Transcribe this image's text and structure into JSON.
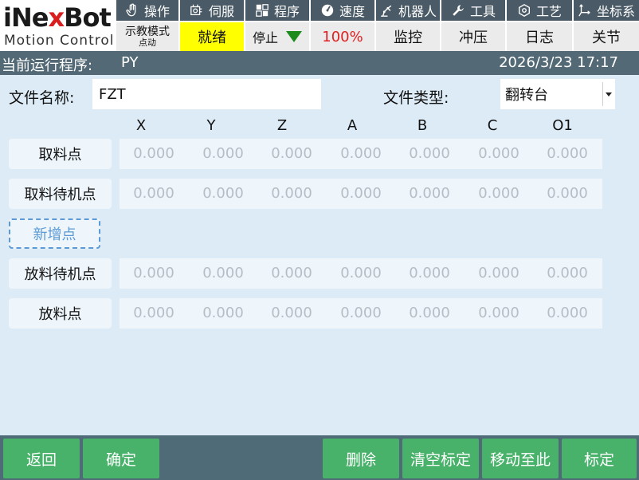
{
  "logo": {
    "brand_pre": "iNe",
    "brand_x": "x",
    "brand_post": "Bot",
    "tagline": "Motion Control"
  },
  "topbar": [
    {
      "label": "操作",
      "icon": "hand-icon"
    },
    {
      "label": "伺服",
      "icon": "servo-icon"
    },
    {
      "label": "程序",
      "icon": "grid-icon"
    },
    {
      "label": "速度",
      "icon": "gauge-icon"
    },
    {
      "label": "机器人",
      "icon": "robot-arm-icon"
    },
    {
      "label": "工具",
      "icon": "wrench-icon"
    },
    {
      "label": "工艺",
      "icon": "hexagon-icon"
    },
    {
      "label": "坐标系",
      "icon": "axis-icon"
    }
  ],
  "status": {
    "mode_label": "示教模式",
    "mode_sub": "点动",
    "ready": "就绪",
    "stop": "停止",
    "speed": "100%",
    "monitor": "监控",
    "stamp": "冲压",
    "log": "日志",
    "joint": "关节"
  },
  "runbar": {
    "label": "当前运行程序:",
    "program": "PY",
    "datetime": "2026/3/23 17:17"
  },
  "form": {
    "file_name_label": "文件名称:",
    "file_name_value": "FZT",
    "file_type_label": "文件类型:",
    "file_type_value": "翻转台"
  },
  "columns": [
    "X",
    "Y",
    "Z",
    "A",
    "B",
    "C",
    "O1"
  ],
  "rows": [
    {
      "name": "取料点",
      "values": [
        "0.000",
        "0.000",
        "0.000",
        "0.000",
        "0.000",
        "0.000",
        "0.000"
      ]
    },
    {
      "name": "取料待机点",
      "values": [
        "0.000",
        "0.000",
        "0.000",
        "0.000",
        "0.000",
        "0.000",
        "0.000"
      ]
    },
    {
      "name": "放料待机点",
      "values": [
        "0.000",
        "0.000",
        "0.000",
        "0.000",
        "0.000",
        "0.000",
        "0.000"
      ]
    },
    {
      "name": "放料点",
      "values": [
        "0.000",
        "0.000",
        "0.000",
        "0.000",
        "0.000",
        "0.000",
        "0.000"
      ]
    }
  ],
  "add_point_label": "新增点",
  "footer": {
    "back": "返回",
    "confirm": "确定",
    "delete": "删除",
    "clear_calib": "清空标定",
    "move_here": "移动至此",
    "calibrate": "标定"
  },
  "colors": {
    "accent_green": "#48b26a",
    "header_slate": "#4a5a66",
    "ready_yellow": "#ffff00",
    "speed_red": "#e02020",
    "panel_blue": "#dcebf6"
  }
}
